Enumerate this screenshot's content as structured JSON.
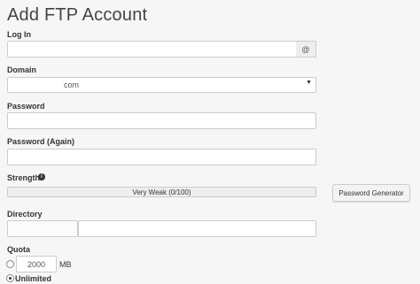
{
  "page_title": "Add FTP Account",
  "login": {
    "label": "Log In",
    "value": "",
    "at_symbol": "@"
  },
  "domain": {
    "label": "Domain",
    "selected": "com"
  },
  "password": {
    "label": "Password",
    "value": ""
  },
  "password_again": {
    "label": "Password (Again)",
    "value": ""
  },
  "strength": {
    "label": "Strength",
    "meter_text": "Very Weak (0/100)",
    "percent": 0
  },
  "password_generator_label": "Password Generator",
  "directory": {
    "label": "Directory",
    "prefix": "",
    "value": ""
  },
  "quota": {
    "label": "Quota",
    "limited_value": "2000",
    "unit": "MB",
    "unlimited_label": "Unlimited",
    "selected": "unlimited"
  }
}
